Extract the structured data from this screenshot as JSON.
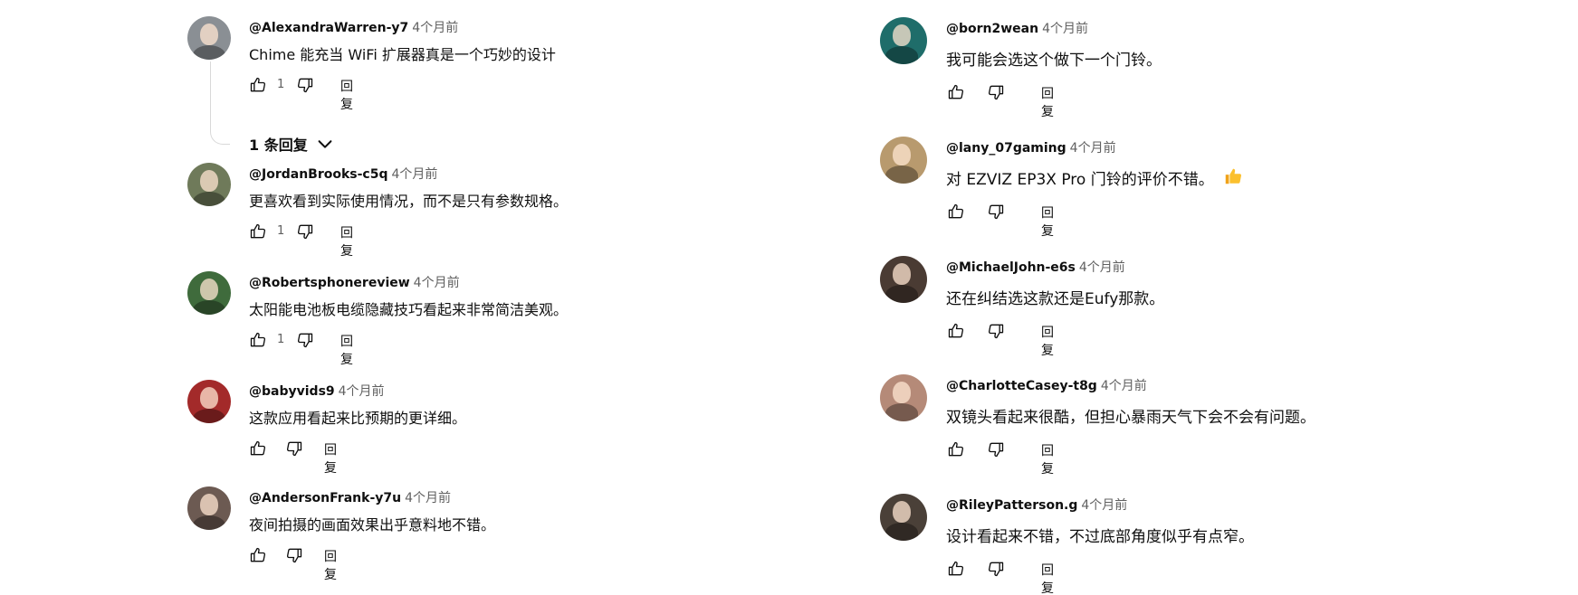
{
  "reply_label": "回复",
  "replies_toggle_label": "1 条回复",
  "left_comments": [
    {
      "author": "@AlexandraWarren-y7",
      "time": "4个月前",
      "text": "Chime 能充当 WiFi 扩展器真是一个巧妙的设计",
      "likes": "1",
      "avatar_color": "#8a8f94"
    },
    {
      "author": "@JordanBrooks-c5q",
      "time": "4个月前",
      "text": "更喜欢看到实际使用情况，而不是只有参数规格。",
      "likes": "1",
      "avatar_color": "#6f7a5a"
    },
    {
      "author": "@Robertsphonereview",
      "time": "4个月前",
      "text": "太阳能电池板电缆隐藏技巧看起来非常简洁美观。",
      "likes": "1",
      "avatar_color": "#3f6b3c"
    },
    {
      "author": "@babyvids9",
      "time": "4个月前",
      "text": "这款应用看起来比预期的更详细。",
      "likes": "",
      "avatar_color": "#a32a2a"
    },
    {
      "author": "@AndersonFrank-y7u",
      "time": "4个月前",
      "text": "夜间拍摄的画面效果出乎意料地不错。",
      "likes": "",
      "avatar_color": "#6c5a52"
    }
  ],
  "right_comments": [
    {
      "author": "@born2wean",
      "time": "4个月前",
      "text": "我可能会选这个做下一个门铃。",
      "likes": "",
      "avatar_color": "#1f6d6a"
    },
    {
      "author": "@lany_07gaming",
      "time": "4个月前",
      "text": "对 EZVIZ EP3X Pro 门铃的评价不错。",
      "likes": "",
      "avatar_color": "#b89a6e",
      "emoji": "thumbs-up-emoji"
    },
    {
      "author": "@MichaelJohn-e6s",
      "time": "4个月前",
      "text": "还在纠结选这款还是Eufy那款。",
      "likes": "",
      "avatar_color": "#4a3b33"
    },
    {
      "author": "@CharlotteCasey-t8g",
      "time": "4个月前",
      "text": "双镜头看起来很酷，但担心暴雨天气下会不会有问题。",
      "likes": "",
      "avatar_color": "#b58a78"
    },
    {
      "author": "@RileyPatterson.g",
      "time": "4个月前",
      "text": "设计看起来不错，不过底部角度似乎有点窄。",
      "likes": "",
      "avatar_color": "#4a4038"
    }
  ]
}
